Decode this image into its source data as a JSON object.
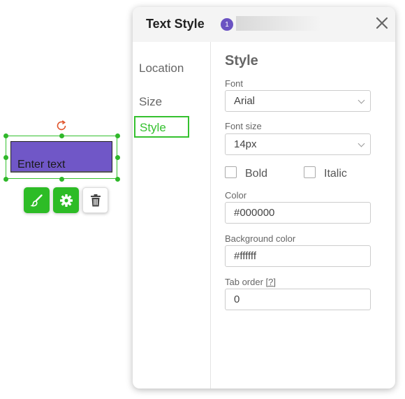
{
  "canvas": {
    "textfield_placeholder": "Enter text",
    "field_color": "#7057c7",
    "selection_color": "#35c12f",
    "tools": [
      {
        "name": "style-brush",
        "icon": "paintbrush-icon"
      },
      {
        "name": "settings",
        "icon": "gear-icon"
      },
      {
        "name": "delete",
        "icon": "trash-icon"
      }
    ]
  },
  "dialog": {
    "title": "Text Style",
    "badge": "1",
    "nav": [
      {
        "label": "Location"
      },
      {
        "label": "Size"
      },
      {
        "label": "Style"
      }
    ],
    "active_nav": "Style",
    "section_title": "Style",
    "font": {
      "label": "Font",
      "value": "Arial"
    },
    "font_size": {
      "label": "Font size",
      "value": "14px"
    },
    "bold": {
      "label": "Bold",
      "checked": false
    },
    "italic": {
      "label": "Italic",
      "checked": false
    },
    "color": {
      "label": "Color",
      "value": "#000000"
    },
    "background_color": {
      "label": "Background color",
      "value": "#ffffff"
    },
    "tab_order": {
      "label": "Tab order",
      "help": "[?]",
      "value": "0"
    },
    "accent_color": "#35c12f"
  }
}
